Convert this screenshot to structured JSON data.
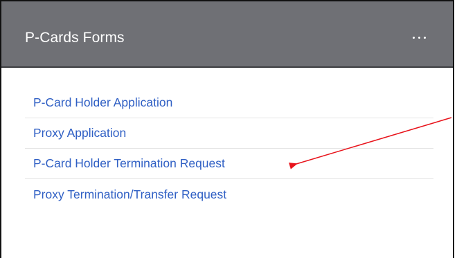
{
  "panel": {
    "title": "P-Cards Forms",
    "menu_icon": "more-horizontal-icon"
  },
  "links": [
    {
      "label": "P-Card Holder Application"
    },
    {
      "label": "Proxy Application"
    },
    {
      "label": "P-Card Holder Termination Request"
    },
    {
      "label": "Proxy Termination/Transfer Request"
    }
  ],
  "annotation": {
    "arrow_color": "#e8131b",
    "points_to": "P-Card Holder Termination Request"
  }
}
